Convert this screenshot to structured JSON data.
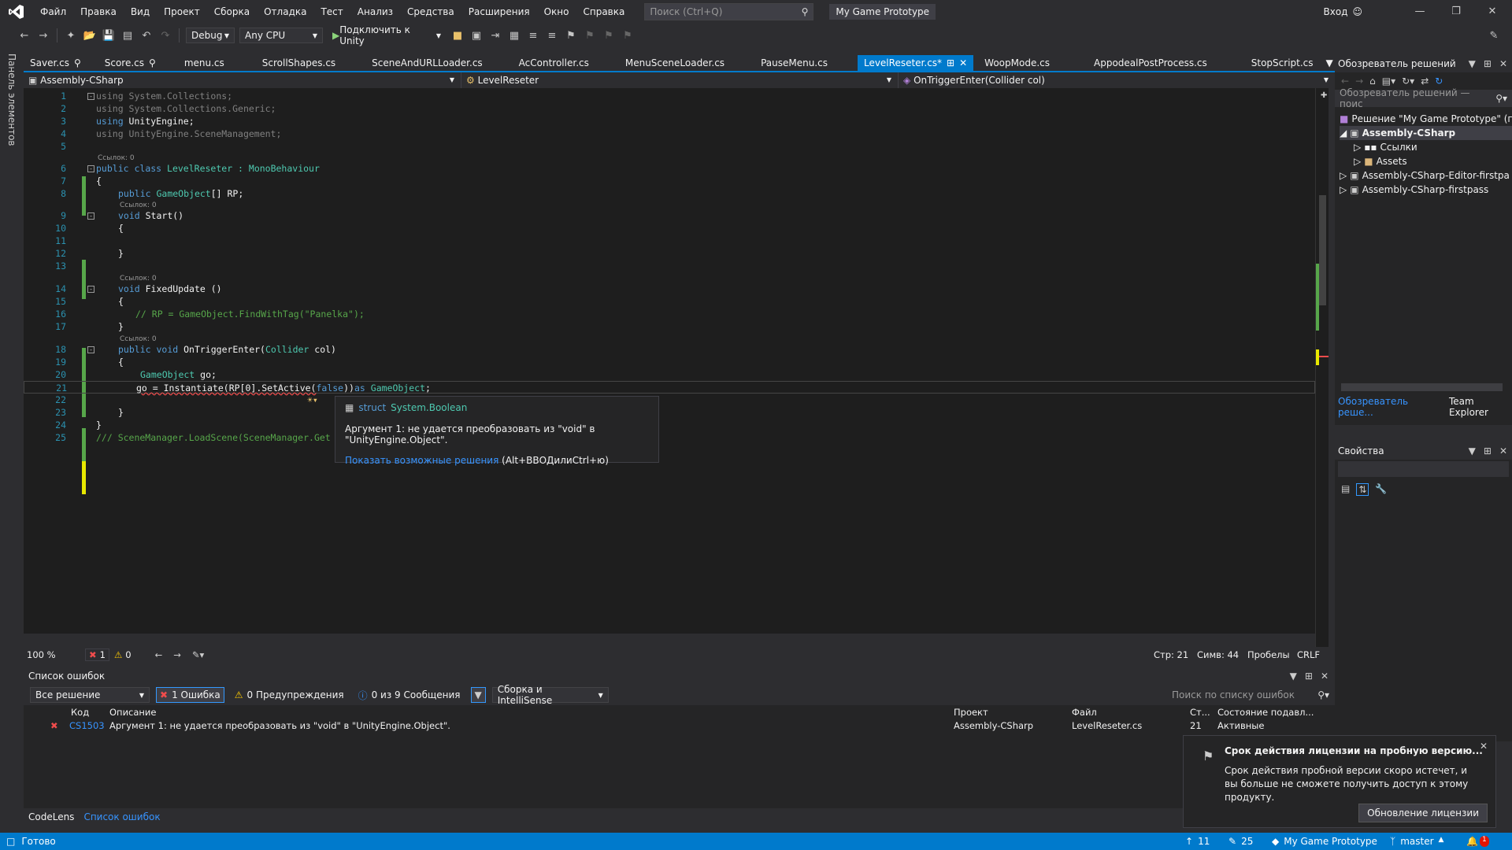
{
  "menubar": {
    "items": [
      "Файл",
      "Правка",
      "Вид",
      "Проект",
      "Сборка",
      "Отладка",
      "Тест",
      "Анализ",
      "Средства",
      "Расширения",
      "Окно",
      "Справка"
    ],
    "search_placeholder": "Поиск (Ctrl+Q)",
    "solution_name": "My Game Prototype",
    "login": "Вход"
  },
  "toolbar": {
    "config": "Debug",
    "platform": "Any CPU",
    "attach": "Подключить к Unity"
  },
  "leftstrip": {
    "label": "Панель элементов"
  },
  "tabs": [
    {
      "label": "Saver.cs"
    },
    {
      "label": "Score.cs"
    },
    {
      "label": "menu.cs"
    },
    {
      "label": "ScrollShapes.cs"
    },
    {
      "label": "SceneAndURLLoader.cs"
    },
    {
      "label": "AcController.cs"
    },
    {
      "label": "MenuSceneLoader.cs"
    },
    {
      "label": "PauseMenu.cs"
    },
    {
      "label": "LevelReseter.cs*",
      "active": true
    },
    {
      "label": "WoopMode.cs"
    },
    {
      "label": "AppodealPostProcess.cs"
    },
    {
      "label": "StopScript.cs"
    }
  ],
  "nav": {
    "project": "Assembly-CSharp",
    "class": "LevelReseter",
    "member": "OnTriggerEnter(Collider col)"
  },
  "code": {
    "l1": "1",
    "l2": "2",
    "l3": "3",
    "l4": "4",
    "l5": "5",
    "l6": "6",
    "l7": "7",
    "l8": "8",
    "l9": "9",
    "l10": "10",
    "l11": "11",
    "l12": "12",
    "l13": "13",
    "l14": "14",
    "l15": "15",
    "l16": "16",
    "l17": "17",
    "l18": "18",
    "l19": "19",
    "l20": "20",
    "l21": "21",
    "l22": "22",
    "l23": "23",
    "l24": "24",
    "l25": "25",
    "refs": "Ссылок: 0",
    "using": "using",
    "ns1": " System.Collections;",
    "ns2": " System.Collections.Generic;",
    "ns3": " UnityEngine;",
    "ns4": " UnityEngine.SceneManagement;",
    "public": "public",
    "class": "class",
    "classname": " LevelReseter : ",
    "mono": "MonoBehaviour",
    "gameobject": "GameObject",
    "rpdecl": "[] RP;",
    "void": "void",
    "start": " Start()",
    "fixed": " FixedUpdate ()",
    "comment16": "// RP = GameObject.FindWithTag(\"Panelka\");",
    "ontrig": " OnTriggerEnter(",
    "collider": "Collider",
    " col": " col)",
    "go": " go;",
    "l21a": "go = Instantiate(RP[0].SetActive(",
    "false": "false",
    "l21b": "))",
    "as": "as",
    "comment25": "/// SceneManager.LoadScene(SceneManager.Get",
    "ob": "{",
    "cb": "}"
  },
  "tooltip": {
    "struct": "struct",
    "type": "System.Boolean",
    "message": "Аргумент 1: не удается преобразовать из \"void\" в \"UnityEngine.Object\".",
    "link": "Показать возможные решения",
    "shortcut": "(Alt+ВВОДилиCtrl+ю)"
  },
  "editor_status": {
    "zoom": "100 %",
    "errors": "1",
    "warnings": "0",
    "line": "Стр: 21",
    "col": "Симв: 44",
    "spaces": "Пробелы",
    "eol": "CRLF"
  },
  "errorlist": {
    "title": "Список ошибок",
    "scope": "Все решение",
    "errors": "1 Ошибка",
    "warnings": "0 Предупреждения",
    "messages": "0 из 9 Сообщения",
    "build": "Сборка и IntelliSense",
    "search": "Поиск по списку ошибок",
    "columns": [
      "Код",
      "Описание",
      "Проект",
      "Файл",
      "Ст...",
      "Состояние подавл..."
    ],
    "rows": [
      {
        "code": "CS1503",
        "desc": "Аргумент 1: не удается преобразовать из \"void\" в \"UnityEngine.Object\".",
        "project": "Assembly-CSharp",
        "file": "LevelReseter.cs",
        "line": "21",
        "state": "Активные"
      }
    ]
  },
  "bottom_tabs": [
    "CodeLens",
    "Список ошибок"
  ],
  "statusbar": {
    "ready": "Готово",
    "up": "11",
    "pencil": "25",
    "project": "My Game Prototype",
    "branch": "master",
    "bell": "1"
  },
  "solution": {
    "title": "Обозреватель решений",
    "search": "Обозреватель решений — поис",
    "items": [
      "Решение \"My Game Prototype\" (п",
      "Assembly-CSharp",
      "Ссылки",
      "Assets",
      "Assembly-CSharp-Editor-firstpa",
      "Assembly-CSharp-firstpass"
    ],
    "tab1": "Обозреватель реше...",
    "tab2": "Team Explorer"
  },
  "props": {
    "title": "Свойства"
  },
  "notification": {
    "title": "Срок действия лицензии на пробную версию...",
    "body": "Срок действия пробной версии скоро истечет, и вы больше не сможете получить доступ к этому продукту.",
    "button": "Обновление лицензии"
  },
  "colors": {
    "accent": "#007acc",
    "editor_bg": "#1e1e1e",
    "keyword": "#569cd6",
    "type": "#4ec9b0",
    "comment": "#57a64a"
  }
}
